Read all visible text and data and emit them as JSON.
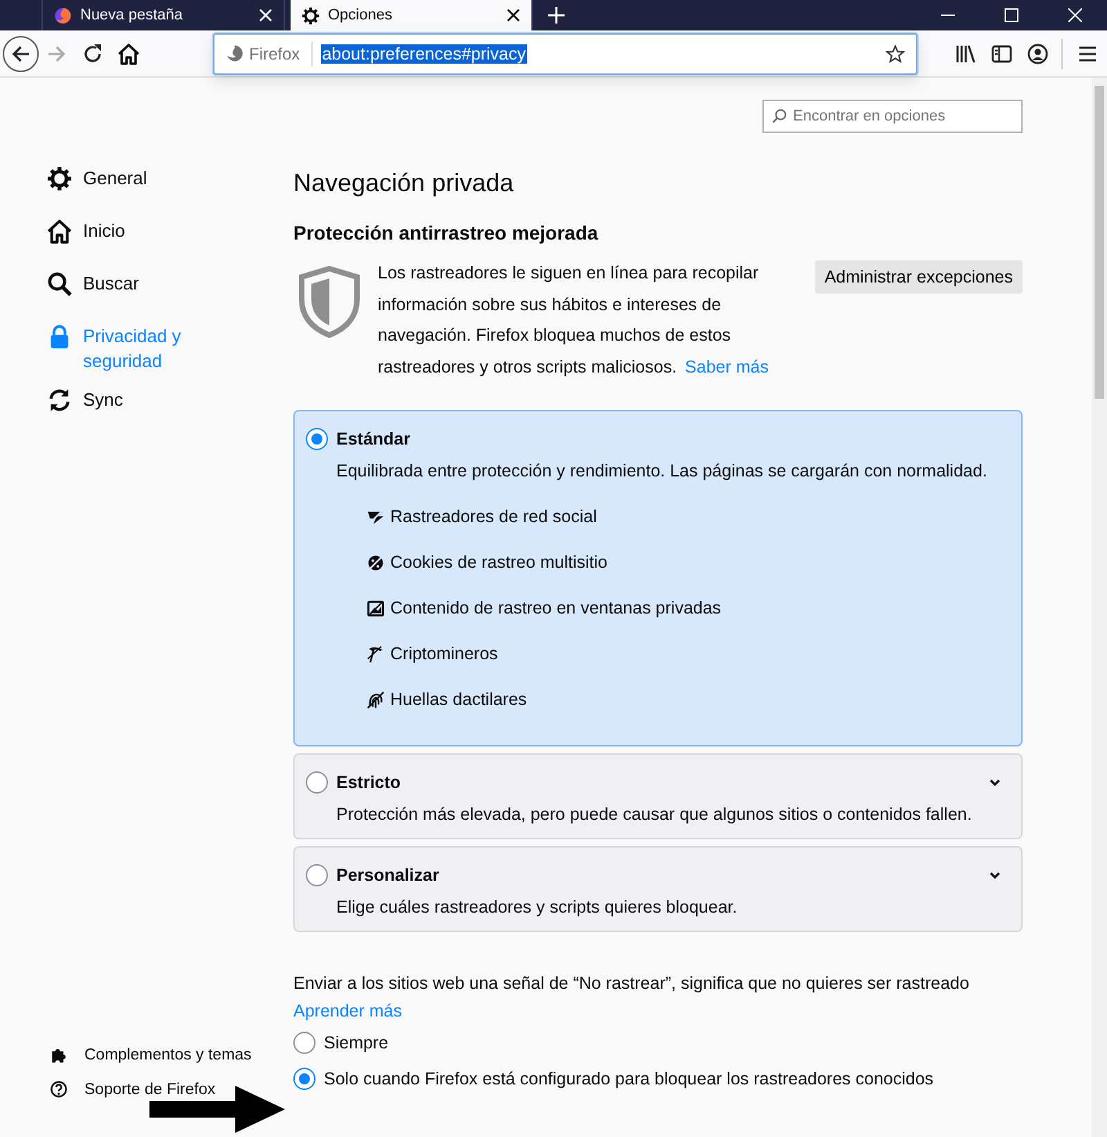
{
  "tabs": [
    {
      "title": "Nueva pestaña",
      "selected": false
    },
    {
      "title": "Opciones",
      "selected": true
    }
  ],
  "toolbar": {
    "identity": "Firefox",
    "url": "about:preferences#privacy"
  },
  "search": {
    "placeholder": "Encontrar en opciones"
  },
  "sidebar": {
    "items": [
      {
        "label": "General",
        "selected": false
      },
      {
        "label": "Inicio",
        "selected": false
      },
      {
        "label": "Buscar",
        "selected": false
      },
      {
        "label": "Privacidad y seguridad",
        "selected": true
      },
      {
        "label": "Sync",
        "selected": false
      }
    ],
    "footer": [
      {
        "label": "Complementos y temas"
      },
      {
        "label": "Soporte de Firefox"
      }
    ]
  },
  "page": {
    "heading": "Navegación privada",
    "section_title": "Protección antirrastreo mejorada",
    "description": "Los rastreadores le siguen en línea para recopilar información sobre sus hábitos e intereses de navegación. Firefox bloquea muchos de estos rastreadores y otros scripts maliciosos.",
    "learn_more": "Saber más",
    "manage_button": "Administrar excepciones",
    "options": [
      {
        "title": "Estándar",
        "description": "Equilibrada entre protección y rendimiento. Las páginas se cargarán con normalidad.",
        "selected": true,
        "expanded": true,
        "features": [
          "Rastreadores de red social",
          "Cookies de rastreo multisitio",
          "Contenido de rastreo en ventanas privadas",
          "Criptomineros",
          "Huellas dactilares"
        ]
      },
      {
        "title": "Estricto",
        "description": "Protección más elevada, pero puede causar que algunos sitios o contenidos fallen.",
        "selected": false,
        "expanded": false
      },
      {
        "title": "Personalizar",
        "description": "Elige cuáles rastreadores y scripts quieres bloquear.",
        "selected": false,
        "expanded": false
      }
    ],
    "dnt": {
      "text": "Enviar a los sitios web una señal de “No rastrear”, significa que no quieres ser rastreado",
      "link": "Aprender más",
      "choices": [
        {
          "label": "Siempre",
          "selected": false
        },
        {
          "label": "Solo cuando Firefox está configurado para bloquear los rastreadores conocidos",
          "selected": true
        }
      ]
    }
  }
}
